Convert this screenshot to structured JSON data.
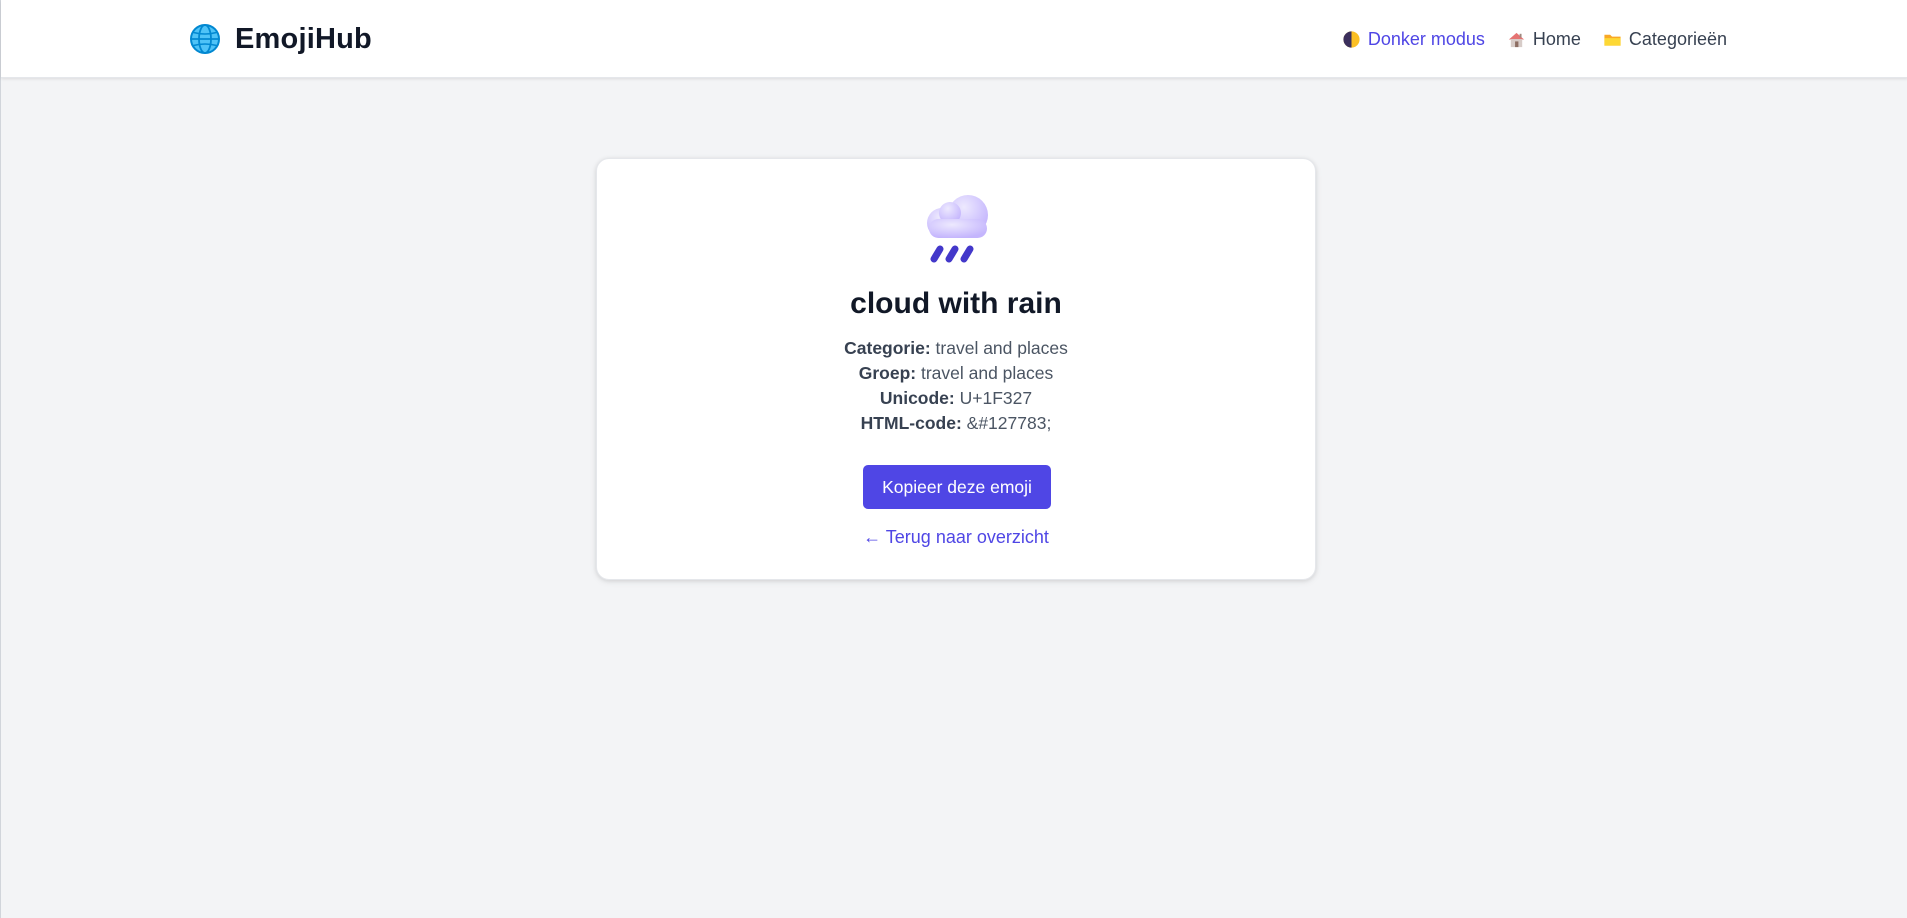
{
  "header": {
    "brand": "EmojiHub",
    "brand_icon": "globe-icon",
    "nav": {
      "dark_mode": "Donker modus",
      "home": "Home",
      "categories": "Categorieën"
    }
  },
  "emoji": {
    "icon": "cloud-with-rain-icon",
    "name": "cloud with rain",
    "category_label": "Categorie:",
    "category": "travel and places",
    "group_label": "Groep:",
    "group": "travel and places",
    "unicode_label": "Unicode:",
    "unicode": "U+1F327",
    "html_code_label": "HTML-code:",
    "html_code": "&#127783;"
  },
  "actions": {
    "copy_label": "Kopieer deze emoji",
    "back_label": "← Terug naar overzicht"
  },
  "colors": {
    "accent": "#4f46e5",
    "background": "#f3f4f6",
    "card": "#ffffff",
    "heading": "#111827"
  }
}
